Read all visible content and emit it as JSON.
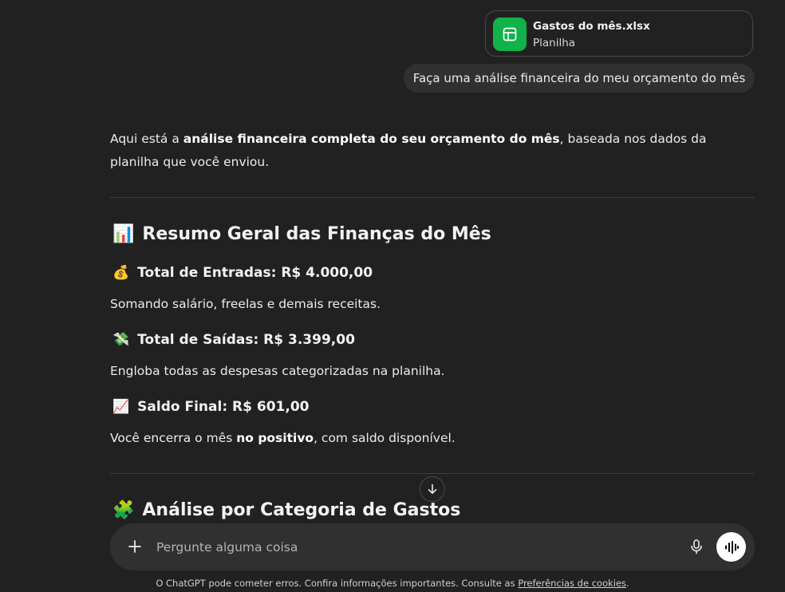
{
  "attachment": {
    "name": "Gastos do mês.xlsx",
    "type": "Planilha",
    "icon": "spreadsheet-icon",
    "color": "#10b34a"
  },
  "user_message": "Faça uma análise financeira do meu orçamento do mês",
  "assistant": {
    "intro_pre": "Aqui está a ",
    "intro_bold": "análise financeira completa do seu orçamento do mês",
    "intro_post": ", baseada nos dados da planilha que você enviou.",
    "section1": {
      "emoji": "📊",
      "title": "Resumo Geral das Finanças do Mês"
    },
    "entradas": {
      "emoji": "💰",
      "title": "Total de Entradas: R$ 4.000,00",
      "text": "Somando salário, freelas e demais receitas."
    },
    "saidas": {
      "emoji": "💸",
      "title": "Total de Saídas: R$ 3.399,00",
      "text": "Engloba todas as despesas categorizadas na planilha."
    },
    "saldo": {
      "emoji": "📈",
      "title": "Saldo Final: R$ 601,00",
      "text_pre": "Você encerra o mês ",
      "text_bold": "no positivo",
      "text_post": ", com saldo disponível."
    },
    "section2": {
      "emoji": "🧩",
      "title": "Análise por Categoria de Gastos"
    }
  },
  "composer": {
    "placeholder": "Pergunte alguma coisa"
  },
  "footer": {
    "text": "O ChatGPT pode cometer erros. Confira informações importantes. Consulte as ",
    "link": "Preferências de cookies",
    "end": "."
  }
}
